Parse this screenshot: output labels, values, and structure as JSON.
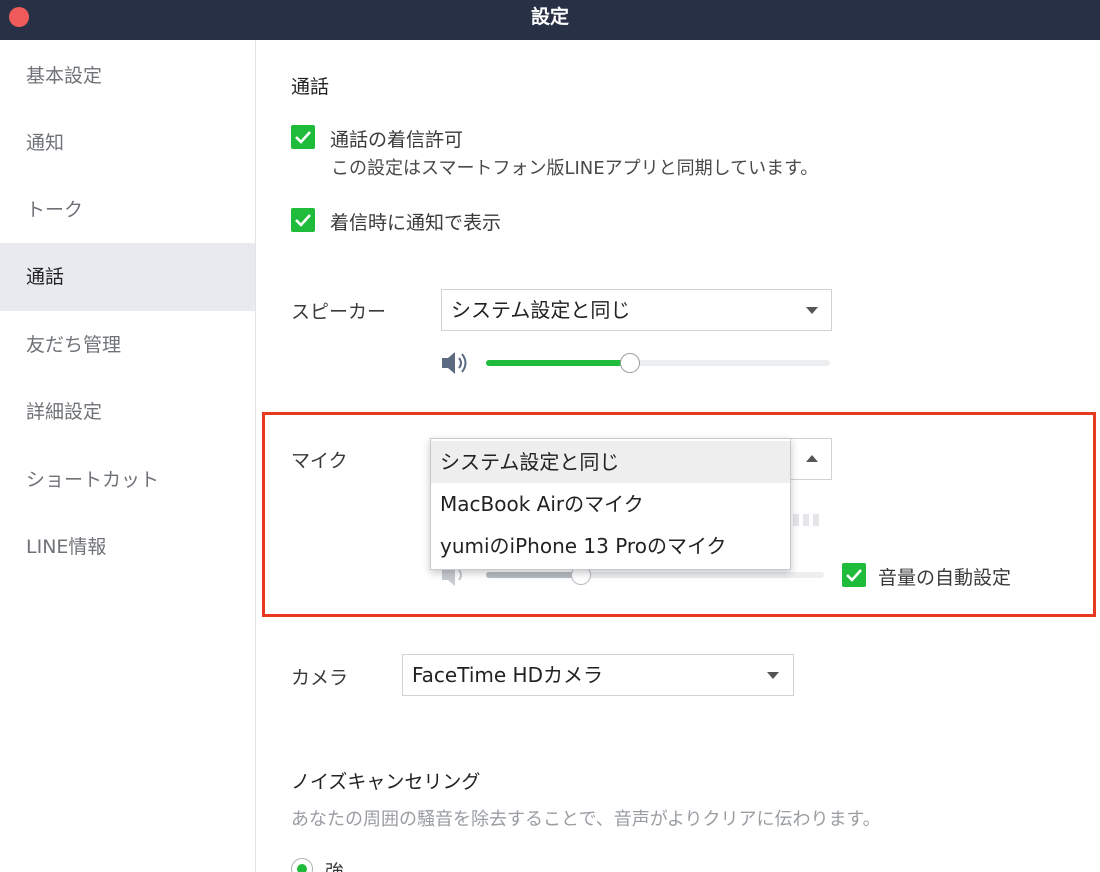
{
  "window": {
    "title": "設定"
  },
  "sidebar": {
    "items": [
      {
        "label": "基本設定"
      },
      {
        "label": "通知"
      },
      {
        "label": "トーク"
      },
      {
        "label": "通話"
      },
      {
        "label": "友だち管理"
      },
      {
        "label": "詳細設定"
      },
      {
        "label": "ショートカット"
      },
      {
        "label": "LINE情報"
      }
    ],
    "active_index": 3
  },
  "call": {
    "section_title": "通話",
    "allow_incoming": {
      "label": "通話の着信許可",
      "checked": true,
      "note": "この設定はスマートフォン版LINEアプリと同期しています。"
    },
    "notify_on_incoming": {
      "label": "着信時に通知で表示",
      "checked": true
    },
    "speaker": {
      "label": "スピーカー",
      "selected": "システム設定と同じ",
      "volume": 0.42
    },
    "mic": {
      "label": "マイク",
      "selected": "システム設定と同じ",
      "options": [
        "システム設定と同じ",
        "MacBook Airのマイク",
        "yumiのiPhone 13 Proのマイク"
      ],
      "volume": 0.28,
      "auto_volume": {
        "label": "音量の自動設定",
        "checked": true
      }
    },
    "camera": {
      "label": "カメラ",
      "selected": "FaceTime HDカメラ"
    },
    "noise_cancel": {
      "title": "ノイズキャンセリング",
      "description": "あなたの周囲の騒音を除去することで、音声がよりクリアに伝わります。",
      "option_strong": "強",
      "selected": "強"
    }
  },
  "colors": {
    "accent": "#1fbc3c",
    "titlebar": "#283046",
    "highlight_border": "#e8381d",
    "close_button": "#ee5b5a"
  },
  "icons": {
    "speaker": "speaker-icon",
    "check": "checkmark-icon",
    "caret_down": "caret-down-icon",
    "caret_up": "caret-up-icon"
  }
}
